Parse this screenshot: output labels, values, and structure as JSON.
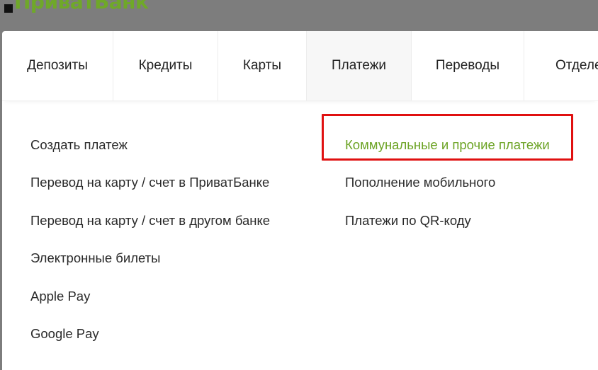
{
  "logo": {
    "text": "ПриватБанк",
    "color": "#6fa829"
  },
  "tabs": [
    {
      "label": "Депозиты",
      "active": false
    },
    {
      "label": "Кредиты",
      "active": false
    },
    {
      "label": "Карты",
      "active": false
    },
    {
      "label": "Платежи",
      "active": true
    },
    {
      "label": "Переводы",
      "active": false
    },
    {
      "label": "Отделе",
      "active": false
    }
  ],
  "menu": {
    "left": [
      {
        "label": "Создать платеж"
      },
      {
        "label": "Перевод на карту / счет в ПриватБанке"
      },
      {
        "label": "Перевод на карту / счет в другом банке"
      },
      {
        "label": "Электронные билеты"
      },
      {
        "label": "Apple Pay"
      },
      {
        "label": "Google Pay"
      }
    ],
    "right": [
      {
        "label": "Коммунальные и прочие платежи",
        "highlighted": true
      },
      {
        "label": "Пополнение мобильного"
      },
      {
        "label": "Платежи по QR-коду"
      }
    ]
  },
  "colors": {
    "accent_green": "#6ca324",
    "highlight_border": "#e01010",
    "backdrop": "#7d7d7d"
  }
}
